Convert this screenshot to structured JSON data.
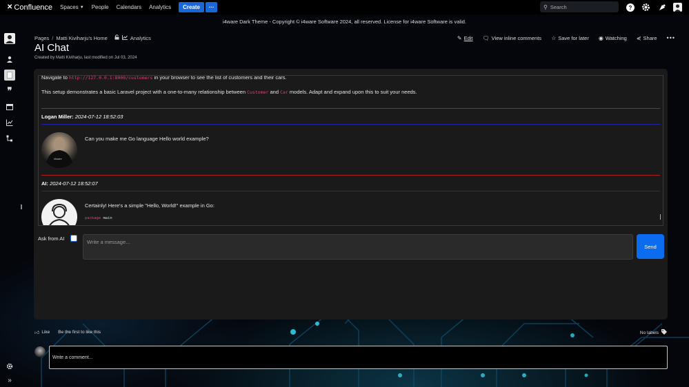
{
  "topnav": {
    "logo": "Confluence",
    "items": [
      {
        "label": "Spaces",
        "has_dropdown": true
      },
      {
        "label": "People"
      },
      {
        "label": "Calendars"
      },
      {
        "label": "Analytics"
      }
    ],
    "create_label": "Create",
    "more_label": "···",
    "search_placeholder": "Search",
    "icons": [
      "help-icon",
      "settings-icon",
      "notifications-icon",
      "user-avatar"
    ]
  },
  "banner": "i4ware Dark Theme - Copyright © i4ware Software 2024, all reserved. License for i4ware Software is valid.",
  "breadcrumb": {
    "pages": "Pages",
    "home": "Matti Kiviharju's Home",
    "analytics": "Analytics"
  },
  "page": {
    "title": "AI Chat",
    "byline": "Created by Matti Kiviharju, last modified on Jul 03, 2024"
  },
  "actions": {
    "edit": "Edit",
    "view_inline": "View inline comments",
    "save_later": "Save for later",
    "watching": "Watching",
    "share": "Share",
    "more": "•••"
  },
  "chat": {
    "top_text_prefix": "Navigate to ",
    "top_text_code": "http://127.0.0.1:8000/customers",
    "top_text_suffix": " in your browser to see the list of customers and their cars.",
    "setup_prefix": "This setup demonstrates a basic Laravel project with a one-to-many relationship between ",
    "setup_code1": "Customer",
    "setup_mid": " and ",
    "setup_code2": "Car",
    "setup_suffix": " models. Adapt and expand upon this to suit your needs.",
    "messages": [
      {
        "speaker": "Logan Miller:",
        "time": "2024-07-12 18:52:03",
        "text": "Can you make me Go language Hello world example?"
      },
      {
        "speaker": "AI:",
        "time": "2024-07-12 18:52:07",
        "text": "Certainly! Here's a simple \"Hello, World!\" example in Go:"
      }
    ],
    "code_keyword": "package",
    "code_rest": " main",
    "ask_label": "Ask from AI",
    "input_placeholder": "Write a message...",
    "send_label": "Send"
  },
  "footer": {
    "like_label": "Like",
    "first_like": "Be the first to like this",
    "no_labels": "No labels",
    "comment_placeholder": "Write a comment..."
  },
  "colors": {
    "accent": "#1868db",
    "send": "#0b6cf0",
    "divider_red": "#b01c1c",
    "divider_blue": "#2323a8",
    "code": "#e0407a"
  }
}
